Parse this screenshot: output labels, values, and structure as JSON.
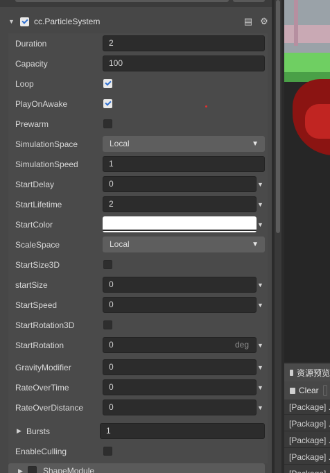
{
  "component": {
    "title": "cc.ParticleSystem",
    "enabled": true
  },
  "properties": [
    {
      "label": "Duration",
      "type": "number",
      "value": "2"
    },
    {
      "label": "Capacity",
      "type": "number",
      "value": "100"
    },
    {
      "label": "Loop",
      "type": "checkbox",
      "checked": true
    },
    {
      "label": "PlayOnAwake",
      "type": "checkbox",
      "checked": true
    },
    {
      "label": "Prewarm",
      "type": "checkbox",
      "checked": false
    },
    {
      "label": "SimulationSpace",
      "type": "select",
      "value": "Local"
    },
    {
      "label": "SimulationSpeed",
      "type": "number",
      "value": "1"
    },
    {
      "label": "StartDelay",
      "type": "curve-number",
      "value": "0"
    },
    {
      "label": "StartLifetime",
      "type": "curve-number",
      "value": "2"
    },
    {
      "label": "StartColor",
      "type": "color",
      "value": "#ffffff"
    },
    {
      "label": "ScaleSpace",
      "type": "select",
      "value": "Local"
    },
    {
      "label": "StartSize3D",
      "type": "checkbox",
      "checked": false
    },
    {
      "label": "startSize",
      "type": "curve-number",
      "value": "0"
    },
    {
      "label": "StartSpeed",
      "type": "curve-number",
      "value": "0"
    },
    {
      "label": "StartRotation3D",
      "type": "checkbox",
      "checked": false
    },
    {
      "label": "StartRotation",
      "type": "curve-number",
      "value": "0",
      "unit": "deg"
    },
    {
      "label": "GravityModifier",
      "type": "curve-number",
      "value": "0"
    },
    {
      "label": "RateOverTime",
      "type": "curve-number",
      "value": "0"
    },
    {
      "label": "RateOverDistance",
      "type": "curve-number",
      "value": "0"
    },
    {
      "label": "Bursts",
      "type": "array",
      "value": "1"
    },
    {
      "label": "EnableCulling",
      "type": "checkbox",
      "checked": false
    }
  ],
  "shape_module": {
    "label": "ShapeModule"
  },
  "assets_panel": {
    "tab_label": "资源预览",
    "clear_label": "Clear",
    "logs": [
      "[Package] ...",
      "[Package] ...",
      "[Package] ...",
      "[Package] ...",
      "[Package] ..."
    ]
  },
  "colors": {
    "accent": "#2e6fd1",
    "panel_bg": "#474747",
    "field_bg": "#2c2c2c"
  }
}
